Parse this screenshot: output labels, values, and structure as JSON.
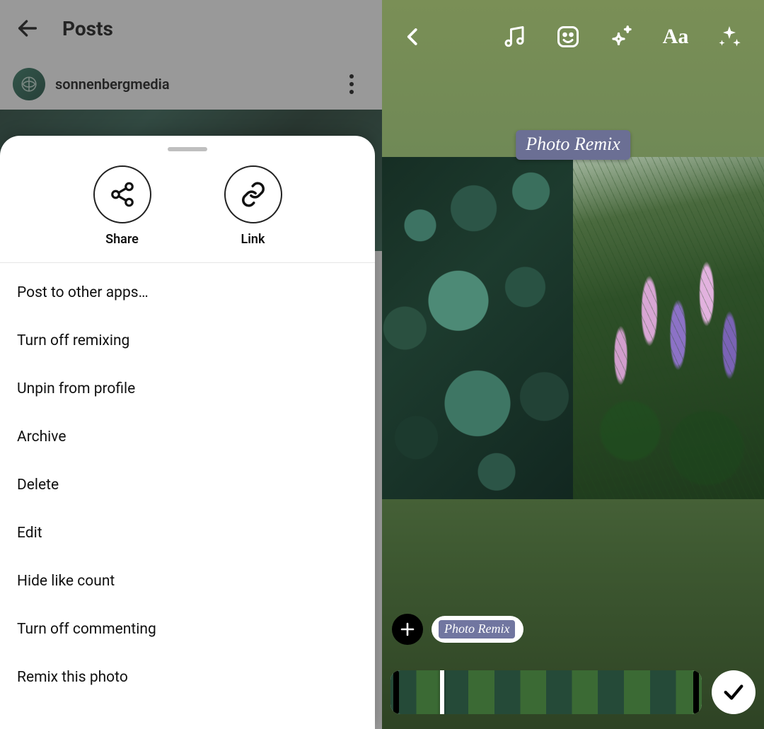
{
  "left": {
    "header_title": "Posts",
    "username": "sonnenbergmedia",
    "sheet": {
      "actions": {
        "share": "Share",
        "link": "Link"
      },
      "menu": [
        "Post to other apps…",
        "Turn off remixing",
        "Unpin from profile",
        "Archive",
        "Delete",
        "Edit",
        "Hide like count",
        "Turn off commenting",
        "Remix this photo"
      ]
    }
  },
  "right": {
    "sticker_label": "Photo Remix",
    "chip_label": "Photo Remix",
    "toolbar_text_icon": "Aa"
  }
}
